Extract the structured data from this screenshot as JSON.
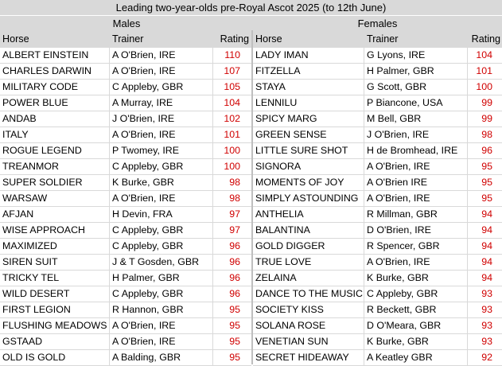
{
  "title": "Leading two-year-olds pre-Royal Ascot 2025 (to 12th June)",
  "males": {
    "label": "Males",
    "headers": {
      "horse": "Horse",
      "trainer": "Trainer",
      "rating": "Rating"
    },
    "rows": [
      {
        "horse": "ALBERT EINSTEIN",
        "trainer": "A O'Brien, IRE",
        "rating": "110"
      },
      {
        "horse": "CHARLES DARWIN",
        "trainer": "A O'Brien, IRE",
        "rating": "107"
      },
      {
        "horse": "MILITARY CODE",
        "trainer": "C Appleby, GBR",
        "rating": "105"
      },
      {
        "horse": "POWER BLUE",
        "trainer": "A Murray, IRE",
        "rating": "104"
      },
      {
        "horse": "ANDAB",
        "trainer": "J O'Brien, IRE",
        "rating": "102"
      },
      {
        "horse": "ITALY",
        "trainer": "A O'Brien, IRE",
        "rating": "101"
      },
      {
        "horse": "ROGUE LEGEND",
        "trainer": "P Twomey, IRE",
        "rating": "100"
      },
      {
        "horse": "TREANMOR",
        "trainer": "C Appleby, GBR",
        "rating": "100"
      },
      {
        "horse": "SUPER SOLDIER",
        "trainer": "K Burke, GBR",
        "rating": "98"
      },
      {
        "horse": "WARSAW",
        "trainer": "A O'Brien, IRE",
        "rating": "98"
      },
      {
        "horse": "AFJAN",
        "trainer": "H Devin, FRA",
        "rating": "97"
      },
      {
        "horse": "WISE APPROACH",
        "trainer": "C Appleby, GBR",
        "rating": "97"
      },
      {
        "horse": "MAXIMIZED",
        "trainer": "C Appleby, GBR",
        "rating": "96"
      },
      {
        "horse": "SIREN SUIT",
        "trainer": "J & T Gosden, GBR",
        "rating": "96"
      },
      {
        "horse": "TRICKY TEL",
        "trainer": "H Palmer, GBR",
        "rating": "96"
      },
      {
        "horse": "WILD DESERT",
        "trainer": "C Appleby, GBR",
        "rating": "96"
      },
      {
        "horse": "FIRST LEGION",
        "trainer": "R Hannon, GBR",
        "rating": "95"
      },
      {
        "horse": "FLUSHING MEADOWS",
        "trainer": "A O'Brien, IRE",
        "rating": "95"
      },
      {
        "horse": "GSTAAD",
        "trainer": "A O'Brien, IRE",
        "rating": "95"
      },
      {
        "horse": "OLD IS GOLD",
        "trainer": "A Balding, GBR",
        "rating": "95"
      }
    ]
  },
  "females": {
    "label": "Females",
    "headers": {
      "horse": "Horse",
      "trainer": "Trainer",
      "rating": "Rating"
    },
    "rows": [
      {
        "horse": "LADY IMAN",
        "trainer": "G Lyons, IRE",
        "rating": "104"
      },
      {
        "horse": "FITZELLA",
        "trainer": "H Palmer, GBR",
        "rating": "101"
      },
      {
        "horse": "STAYA",
        "trainer": "G Scott, GBR",
        "rating": "100"
      },
      {
        "horse": "LENNILU",
        "trainer": "P Biancone, USA",
        "rating": "99"
      },
      {
        "horse": "SPICY MARG",
        "trainer": "M Bell, GBR",
        "rating": "99"
      },
      {
        "horse": "GREEN SENSE",
        "trainer": "J O'Brien, IRE",
        "rating": "98"
      },
      {
        "horse": "LITTLE SURE SHOT",
        "trainer": "H de Bromhead, IRE",
        "rating": "96"
      },
      {
        "horse": "SIGNORA",
        "trainer": "A O'Brien, IRE",
        "rating": "95"
      },
      {
        "horse": "MOMENTS OF JOY",
        "trainer": "A O'Brien IRE",
        "rating": "95"
      },
      {
        "horse": "SIMPLY ASTOUNDING",
        "trainer": "A O'Brien, IRE",
        "rating": "95"
      },
      {
        "horse": "ANTHELIA",
        "trainer": "R Millman, GBR",
        "rating": "94"
      },
      {
        "horse": "BALANTINA",
        "trainer": "D O'Brien, IRE",
        "rating": "94"
      },
      {
        "horse": "GOLD DIGGER",
        "trainer": "R Spencer, GBR",
        "rating": "94"
      },
      {
        "horse": "TRUE LOVE",
        "trainer": "A O'Brien, IRE",
        "rating": "94"
      },
      {
        "horse": "ZELAINA",
        "trainer": "K Burke, GBR",
        "rating": "94"
      },
      {
        "horse": "DANCE TO THE MUSIC",
        "trainer": "C Appleby, GBR",
        "rating": "93"
      },
      {
        "horse": "SOCIETY KISS",
        "trainer": "R Beckett, GBR",
        "rating": "93"
      },
      {
        "horse": "SOLANA ROSE",
        "trainer": "D O'Meara, GBR",
        "rating": "93"
      },
      {
        "horse": "VENETIAN SUN",
        "trainer": "K Burke, GBR",
        "rating": "93"
      },
      {
        "horse": "SECRET HIDEAWAY",
        "trainer": "A Keatley GBR",
        "rating": "92"
      }
    ]
  },
  "colors": {
    "header_bg": "#d9d9d9",
    "rating_text": "#d00000",
    "gridline": "#d9d9d9"
  }
}
